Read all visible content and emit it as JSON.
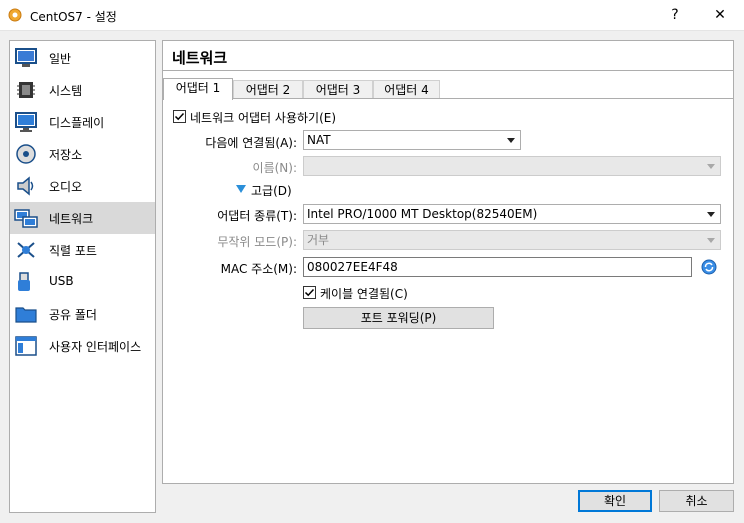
{
  "window": {
    "title": "CentOS7 - 설정",
    "help_label": "?",
    "close_label": "✕"
  },
  "sidebar": {
    "items": [
      {
        "label": "일반",
        "icon": "general-icon"
      },
      {
        "label": "시스템",
        "icon": "system-icon"
      },
      {
        "label": "디스플레이",
        "icon": "display-icon"
      },
      {
        "label": "저장소",
        "icon": "storage-icon"
      },
      {
        "label": "오디오",
        "icon": "audio-icon"
      },
      {
        "label": "네트워크",
        "icon": "network-icon"
      },
      {
        "label": "직렬 포트",
        "icon": "serial-port-icon"
      },
      {
        "label": "USB",
        "icon": "usb-icon"
      },
      {
        "label": "공유 폴더",
        "icon": "shared-folder-icon"
      },
      {
        "label": "사용자 인터페이스",
        "icon": "user-interface-icon"
      }
    ],
    "active_index": 5
  },
  "page": {
    "title": "네트워크"
  },
  "tabs": [
    "어댑터 1",
    "어댑터 2",
    "어댑터 3",
    "어댑터 4"
  ],
  "form": {
    "enable_adapter_label": "네트워크 어댑터 사용하기(E)",
    "enable_adapter_checked": true,
    "attached_to_label": "다음에 연결됨(A):",
    "attached_to_value": "NAT",
    "name_label": "이름(N):",
    "name_value": "",
    "advanced_label": "고급(D)",
    "adapter_type_label": "어댑터 종류(T):",
    "adapter_type_value": "Intel PRO/1000 MT Desktop(82540EM)",
    "promiscuous_label": "무작위 모드(P):",
    "promiscuous_value": "거부",
    "mac_label": "MAC 주소(M):",
    "mac_value": "080027EE4F48",
    "cable_label": "케이블 연결됨(C)",
    "cable_checked": true,
    "port_forwarding_label": "포트 포워딩(P)"
  },
  "buttons": {
    "ok": "확인",
    "cancel": "취소"
  },
  "colors": {
    "accent": "#0078d7",
    "active_item_bg": "#d9d9d9"
  }
}
